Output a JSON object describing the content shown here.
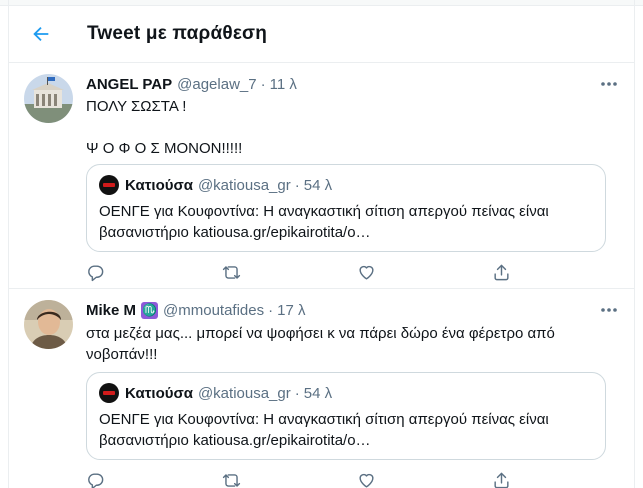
{
  "header": {
    "title": "Tweet με παράθεση"
  },
  "tweets": [
    {
      "name": "ANGEL PAP",
      "handle": "@agelaw_7",
      "time": "11 λ",
      "lines": [
        "ΠΟΛΥ ΣΩΣΤΑ !",
        "Ψ Ο Φ Ο Σ ΜΟΝΟΝ!!!!!"
      ],
      "quote": {
        "name": "Κατιούσα",
        "handle": "@katiousa_gr",
        "time": "54 λ",
        "line1": "ΟΕΝΓΕ για Κουφοντίνα: Η αναγκαστική σίτιση απεργού πείνας είναι",
        "line2": "βασανιστήριο katiousa.gr/epikairotita/o…"
      }
    },
    {
      "name": "Mike M",
      "handle": "@mmoutafides",
      "time": "17 λ",
      "badge": "♏",
      "line1": "στα μεζέα μας... μπορεί να ψοφήσει κ να πάρει δώρο ένα φέρετρο από",
      "line2": "νοβοπάν!!!",
      "quote": {
        "name": "Κατιούσα",
        "handle": "@katiousa_gr",
        "time": "54 λ",
        "line1": "ΟΕΝΓΕ για Κουφοντίνα: Η αναγκαστική σίτιση απεργού πείνας είναι",
        "line2": "βασανιστήριο katiousa.gr/epikairotita/o…"
      }
    }
  ],
  "separator": "·"
}
